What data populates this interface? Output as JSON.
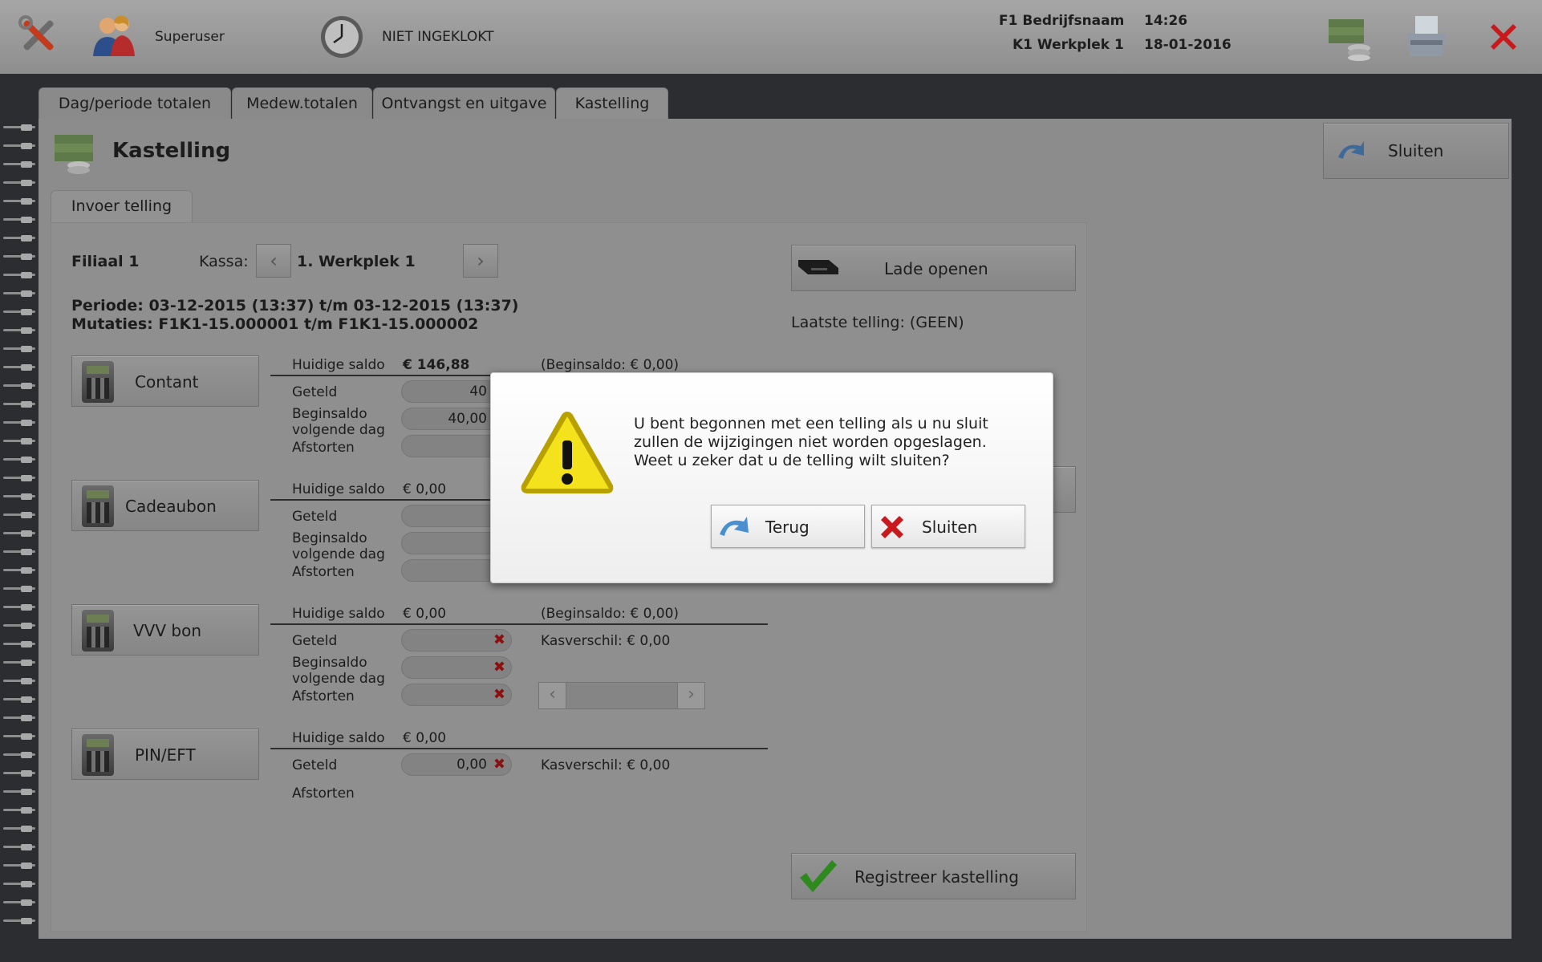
{
  "header": {
    "user": "Superuser",
    "clock_status": "NIET INGEKLOKT",
    "company": "F1 Bedrijfsnaam",
    "workstation": "K1 Werkplek 1",
    "time": "14:26",
    "date": "18-01-2016"
  },
  "tabs": [
    {
      "label": "Dag/periode totalen"
    },
    {
      "label": "Medew.totalen"
    },
    {
      "label": "Ontvangst en uitgave"
    },
    {
      "label": "Kastelling"
    }
  ],
  "page": {
    "title": "Kastelling",
    "close_label": "Sluiten",
    "subtab": "Invoer telling",
    "branch": "Filiaal 1",
    "register_label": "Kassa:",
    "register_value": "1. Werkplek 1",
    "period": "Periode: 03-12-2015 (13:37) t/m 03-12-2015 (13:37)",
    "mutations": "Mutaties: F1K1-15.000001 t/m F1K1-15.000002",
    "drawer_button": "Lade openen",
    "last_count": "Laatste telling: (GEEN)",
    "register_count_button": "Registreer kastelling"
  },
  "labels": {
    "current_balance": "Huidige saldo",
    "counted": "Geteld",
    "opening_next_1": "Beginsaldo",
    "opening_next_2": "volgende dag",
    "deposit": "Afstorten"
  },
  "sections": [
    {
      "name": "Contant",
      "balance": "€ 146,88",
      "opening": "(Beginsaldo: € 0,00)",
      "counted": "40",
      "opening_next": "40,00",
      "deposit": ""
    },
    {
      "name": "Cadeaubon",
      "balance": "€ 0,00",
      "counted": "",
      "opening_next": "",
      "deposit": ""
    },
    {
      "name": "VVV bon",
      "balance": "€ 0,00",
      "opening": "(Beginsaldo: € 0,00)",
      "difference": "Kasverschil: € 0,00",
      "counted": "",
      "opening_next": "",
      "deposit": ""
    },
    {
      "name": "PIN/EFT",
      "balance": "€ 0,00",
      "difference": "Kasverschil: € 0,00",
      "counted": "0,00"
    }
  ],
  "dialog": {
    "line1": "U bent begonnen met een telling als u nu sluit",
    "line2": "zullen de wijzigingen niet worden opgeslagen.",
    "line3": "Weet u zeker dat u de telling wilt sluiten?",
    "back_label": "Terug",
    "close_label": "Sluiten"
  },
  "colors": {
    "accent_green": "#2f8a1e",
    "close_red": "#c8191c",
    "warning_yellow": "#f4e21c"
  }
}
